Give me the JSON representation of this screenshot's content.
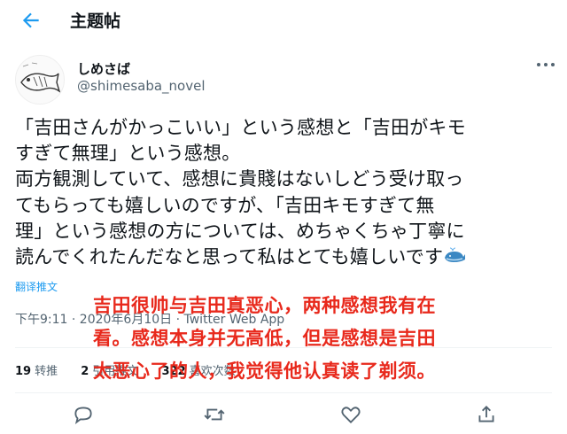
{
  "header": {
    "title": "主题帖",
    "back_icon": "arrow-left-icon"
  },
  "author": {
    "name": "しめさば",
    "handle": "@shimesaba_novel"
  },
  "tweet": {
    "lines": [
      "「吉田さんがかっこいい」という感想と「吉田がキモ",
      "すぎて無理」という感想。",
      "両方観測していて、感想に貴賤はないしどう受け取っ",
      "てもらっても嬉しいのですが、「吉田キモすぎて無",
      "理」という感想の方については、めちゃくちゃ丁寧に",
      "読んでくれたんだなと思って私はとても嬉しいです"
    ],
    "emoji": "whale-icon"
  },
  "translate_label": "翻译推文",
  "timestamp": "下午9:11 · 2020年6月10日 · Twitter Web App",
  "stats": {
    "retweets_count": "19",
    "retweets_label": "转推",
    "quotes_count": "2",
    "quotes_label": "引用推文",
    "likes_count": "322",
    "likes_label": "喜欢次数"
  },
  "overlay_caption": {
    "lines": [
      "吉田很帅与吉田真恶心，两种感想我有在",
      "看。感想本身并无高低，但是感想是吉田",
      "太恶心了的人，我觉得他认真读了剃须。"
    ],
    "color": "#e8291c"
  },
  "actions": [
    "reply-icon",
    "retweet-icon",
    "like-icon",
    "share-icon"
  ],
  "colors": {
    "accent": "#1d9bf0",
    "muted": "#536471",
    "text": "#0f1419"
  }
}
